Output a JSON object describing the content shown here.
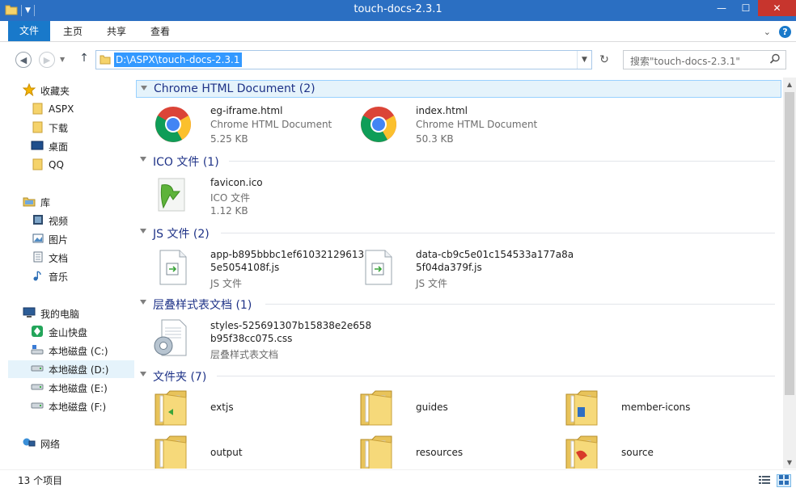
{
  "window": {
    "title": "touch-docs-2.3.1",
    "minimize": "—",
    "maximize": "☐",
    "close": "✕"
  },
  "ribbon": {
    "tabs": [
      "文件",
      "主页",
      "共享",
      "查看"
    ]
  },
  "nav": {
    "address": "D:\\ASPX\\touch-docs-2.3.1",
    "search_placeholder": "搜索\"touch-docs-2.3.1\""
  },
  "sidebar": {
    "favorites": {
      "label": "收藏夹",
      "items": [
        "ASPX",
        "下载",
        "桌面",
        "QQ"
      ]
    },
    "library": {
      "label": "库",
      "items": [
        "视频",
        "图片",
        "文档",
        "音乐"
      ]
    },
    "computer": {
      "label": "我的电脑",
      "items": [
        "金山快盘",
        "本地磁盘 (C:)",
        "本地磁盘 (D:)",
        "本地磁盘 (E:)",
        "本地磁盘 (F:)"
      ]
    },
    "network": {
      "label": "网络"
    },
    "selected": "本地磁盘 (D:)"
  },
  "groups": {
    "chrome": {
      "title": "Chrome HTML Document (2)",
      "files": [
        {
          "name": "eg-iframe.html",
          "type": "Chrome HTML Document",
          "size": "5.25 KB"
        },
        {
          "name": "index.html",
          "type": "Chrome HTML Document",
          "size": "50.3 KB"
        }
      ]
    },
    "ico": {
      "title": "ICO 文件 (1)",
      "files": [
        {
          "name": "favicon.ico",
          "type": "ICO 文件",
          "size": "1.12 KB"
        }
      ]
    },
    "js": {
      "title": "JS 文件 (2)",
      "files": [
        {
          "name_line1": "app-b895bbbc1ef61032129613",
          "name_line2": "5e5054108f.js",
          "type": "JS 文件"
        },
        {
          "name_line1": "data-cb9c5e01c154533a177a8a",
          "name_line2": "5f04da379f.js",
          "type": "JS 文件"
        }
      ]
    },
    "css": {
      "title": "层叠样式表文档 (1)",
      "files": [
        {
          "name_line1": "styles-525691307b15838e2e658",
          "name_line2": "b95f38cc075.css",
          "type": "层叠样式表文档"
        }
      ]
    },
    "folders": {
      "title": "文件夹 (7)",
      "items": [
        "extjs",
        "guides",
        "member-icons",
        "output",
        "resources",
        "source"
      ]
    }
  },
  "status": {
    "count": "13 个项目"
  },
  "colors": {
    "titlebar": "#2b6fc2",
    "file_tab": "#1979ca",
    "close": "#c7352d",
    "group_title": "#1e3287",
    "selection": "#e5f3fb",
    "address_highlight": "#3399ff"
  }
}
